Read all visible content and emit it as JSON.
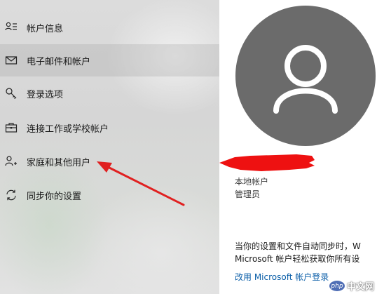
{
  "sidebar": {
    "items": [
      {
        "icon": "account-info-icon",
        "label": "帐户信息",
        "selected": false
      },
      {
        "icon": "email-icon",
        "label": "电子邮件和帐户",
        "selected": true
      },
      {
        "icon": "key-icon",
        "label": "登录选项",
        "selected": false
      },
      {
        "icon": "briefcase-icon",
        "label": "连接工作或学校帐户",
        "selected": false
      },
      {
        "icon": "family-user-icon",
        "label": "家庭和其他用户",
        "selected": false
      },
      {
        "icon": "sync-icon",
        "label": "同步你的设置",
        "selected": false
      }
    ]
  },
  "account": {
    "avatar_icon": "user-avatar-icon",
    "type": "本地帐户",
    "role": "管理员"
  },
  "description": {
    "line1": "当你的设置和文件自动同步时，W",
    "line2": "Microsoft 帐户轻松获取你所有设"
  },
  "link": {
    "label": "改用 Microsoft 帐户登录"
  },
  "annotation": {
    "arrow_color": "#e02020",
    "redaction_color": "#ee1111"
  },
  "watermark": {
    "badge": "php",
    "text": "中文网"
  }
}
